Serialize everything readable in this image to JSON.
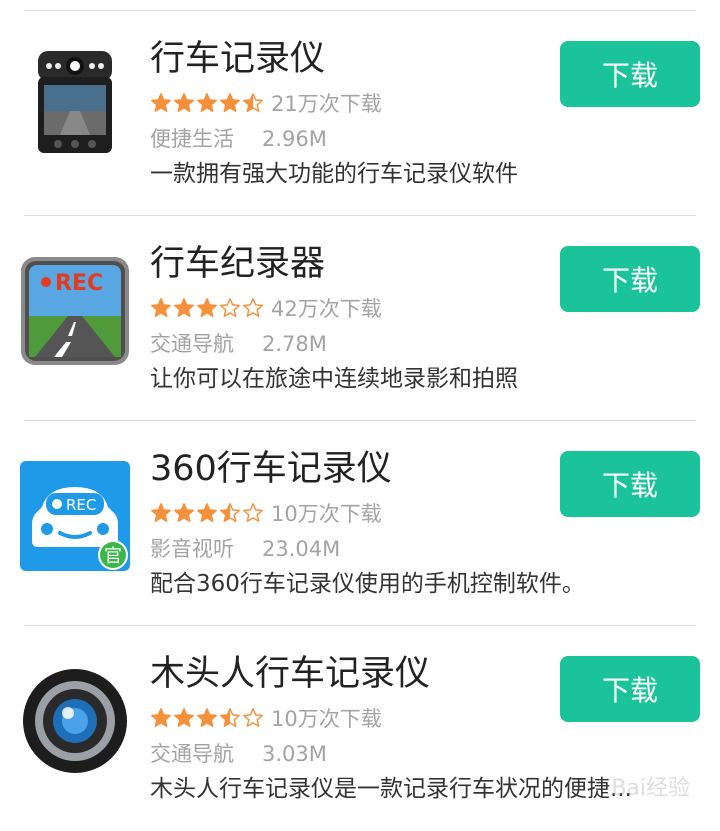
{
  "accent": "#1bc39a",
  "star_color": "#f5913c",
  "apps": [
    {
      "icon": "dashcam-device-icon",
      "title": "行车记录仪",
      "rating": 4.5,
      "downloads": "21万次下载",
      "category": "便捷生活",
      "size": "2.96M",
      "description": "一款拥有强大功能的行车记录仪软件",
      "button": "下载"
    },
    {
      "icon": "rec-road-icon",
      "title": "行车纪录器",
      "rating": 3,
      "downloads": "42万次下载",
      "category": "交通导航",
      "size": "2.78M",
      "description": "让你可以在旅途中连续地录影和拍照",
      "button": "下载",
      "icon_text": "REC"
    },
    {
      "icon": "car-rec-official-icon",
      "title": "360行车记录仪",
      "rating": 3.5,
      "downloads": "10万次下载",
      "category": "影音视听",
      "size": "23.04M",
      "description": "配合360行车记录仪使用的手机控制软件。",
      "button": "下载",
      "icon_text": "REC",
      "badge": "官"
    },
    {
      "icon": "camera-lens-icon",
      "title": "木头人行车记录仪",
      "rating": 3.5,
      "downloads": "10万次下载",
      "category": "交通导航",
      "size": "3.03M",
      "description": "木头人行车记录仪是一款记录行车状况的便捷...",
      "button": "下载"
    }
  ],
  "watermark": "Bai经验"
}
